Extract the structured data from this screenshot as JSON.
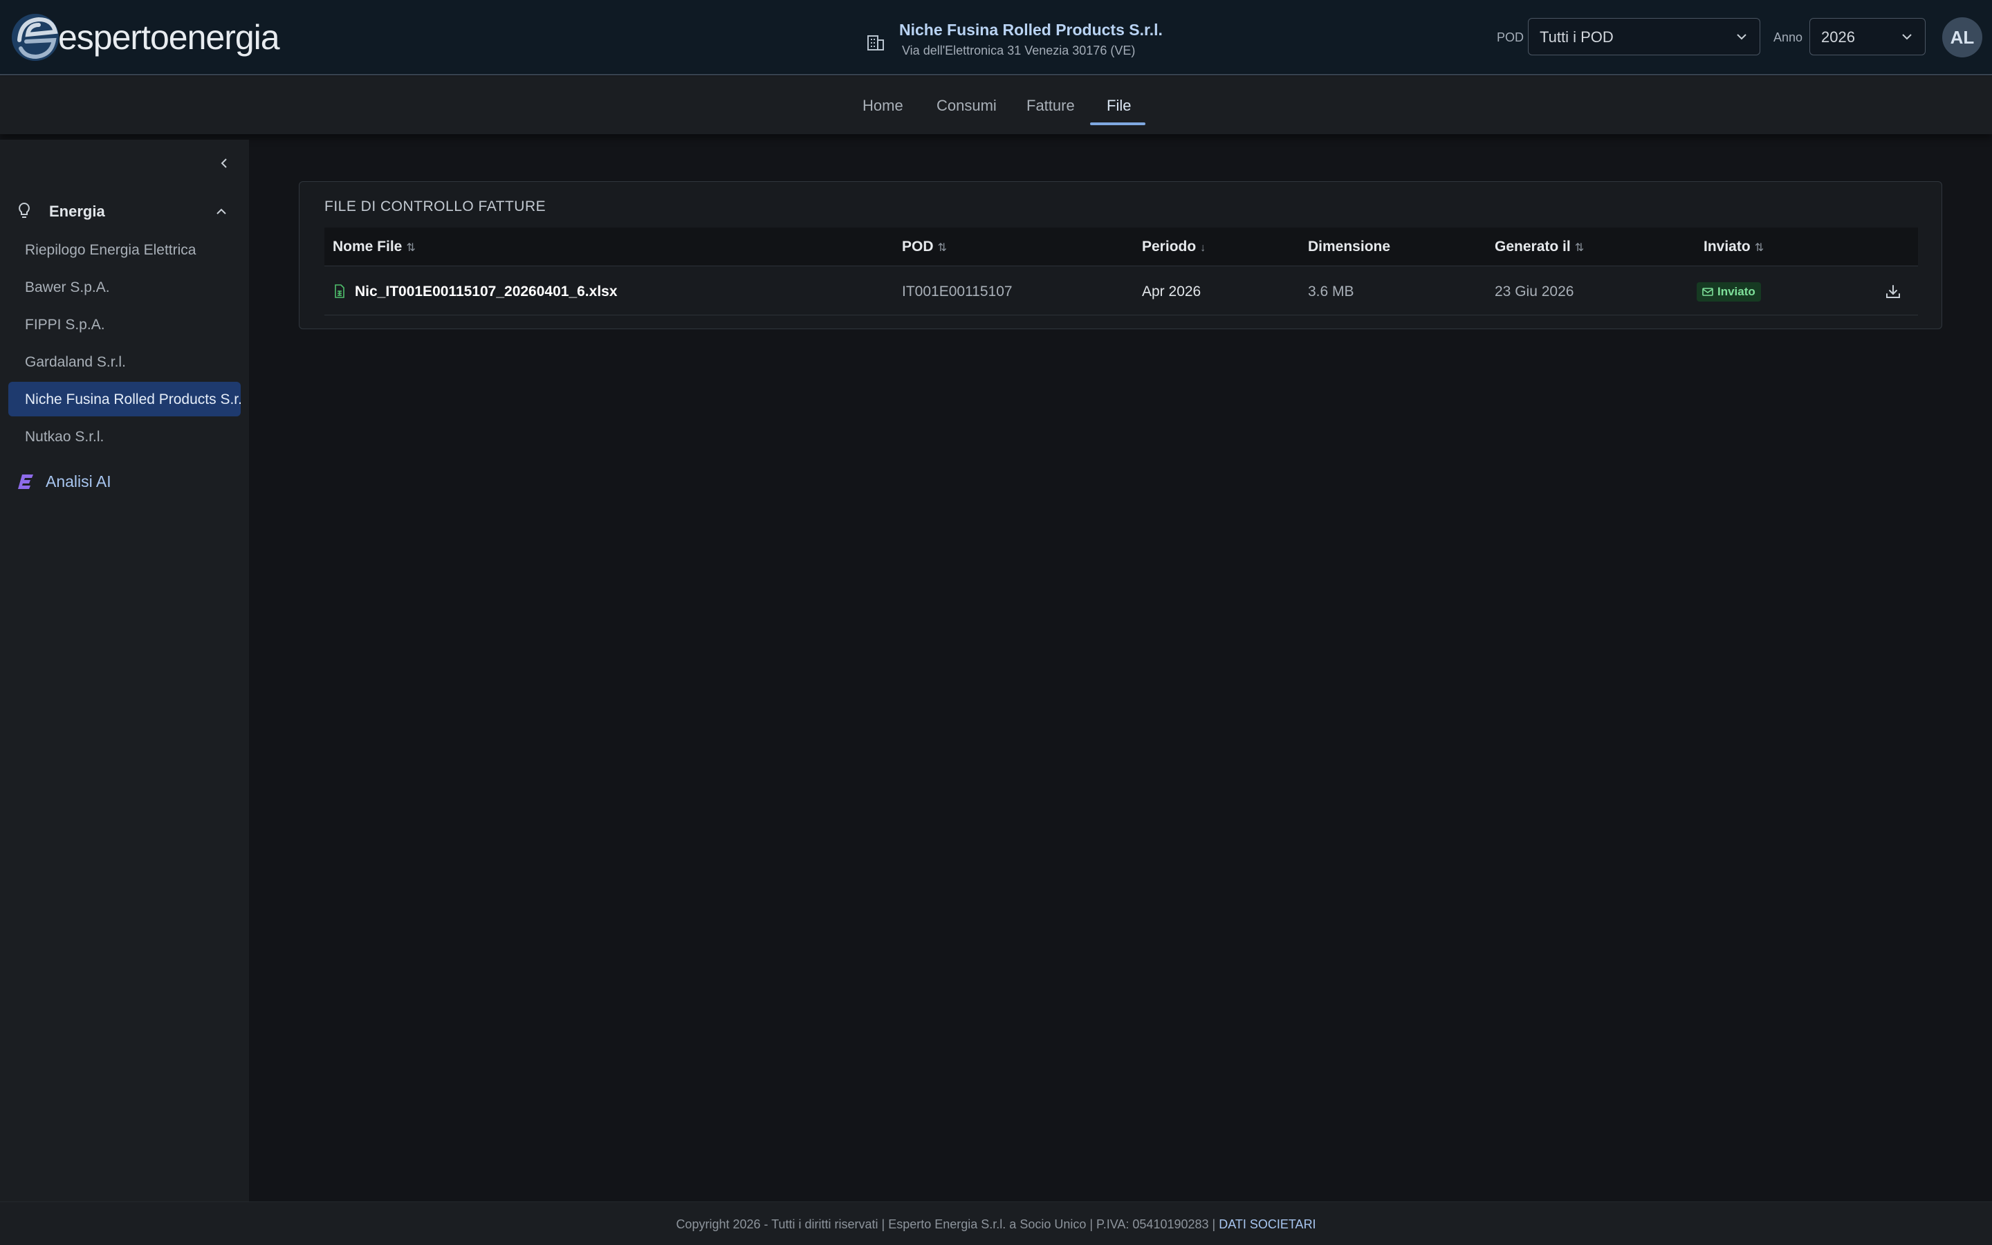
{
  "header": {
    "logo_text": "espertoenergia",
    "company_name": "Niche Fusina Rolled Products S.r.l.",
    "company_address": "Via dell'Elettronica 31 Venezia 30176 (VE)",
    "pod_label": "POD",
    "pod_value": "Tutti i POD",
    "year_label": "Anno",
    "year_value": "2026",
    "avatar_initials": "AL"
  },
  "tabs": [
    {
      "label": "Home"
    },
    {
      "label": "Consumi"
    },
    {
      "label": "Fatture"
    },
    {
      "label": "File",
      "active": true
    }
  ],
  "sidebar": {
    "group_title": "Energia",
    "items": [
      {
        "label": "Riepilogo Energia Elettrica"
      },
      {
        "label": "Bawer S.p.A."
      },
      {
        "label": "FIPPI S.p.A."
      },
      {
        "label": "Gardaland S.r.l."
      },
      {
        "label": "Niche Fusina Rolled Products S.r.l.",
        "active": true
      },
      {
        "label": "Nutkao S.r.l."
      }
    ],
    "ai_label": "Analisi AI"
  },
  "card": {
    "title": "FILE DI CONTROLLO FATTURE",
    "columns": [
      "Nome File",
      "POD",
      "Periodo",
      "Dimensione",
      "Generato il",
      "Inviato"
    ],
    "rows": [
      {
        "file": "Nic_IT001E00115107_20260401_6.xlsx",
        "pod": "IT001E00115107",
        "period": "Apr 2026",
        "size": "3.6 MB",
        "generated": "23 Giu 2026",
        "sent": "Inviato"
      }
    ]
  },
  "footer": {
    "text": "Copyright 2026 - Tutti i diritti riservati | Esperto Energia S.r.l. a Socio Unico | P.IVA: 05410190283 | ",
    "link": "DATI SOCIETARI"
  },
  "colors": {
    "accent": "#7fa8e0",
    "active_sidebar": "#1e3a6e",
    "success_badge_bg": "#163a22",
    "success_badge_text": "#7ee09a"
  }
}
